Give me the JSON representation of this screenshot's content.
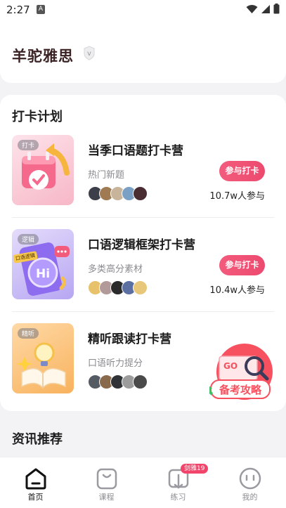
{
  "status_bar": {
    "time": "2:27",
    "notification_letter": "A"
  },
  "header": {
    "brand": "羊驼雅思",
    "badge_letter": "v"
  },
  "plan_section": {
    "title": "打卡计划",
    "camps": [
      {
        "tag": "打卡",
        "title": "当季口语题打卡营",
        "subtitle": "热门新题",
        "join_label": "参与打卡",
        "count": "10.7w人参与",
        "accent": "#f7b7c7"
      },
      {
        "tag": "逻辑",
        "tag2": "口语逻辑",
        "title": "口语逻辑框架打卡营",
        "subtitle": "多类高分素材",
        "join_label": "参与打卡",
        "count": "10.4w人参与",
        "accent": "#b7a6f2"
      },
      {
        "tag": "精听",
        "title": "精听跟读打卡营",
        "subtitle": "口语听力提分",
        "accent": "#f8c27a"
      }
    ],
    "promo": {
      "label": "备考攻略",
      "mini": "GO"
    }
  },
  "news_section": {
    "title": "资讯推荐"
  },
  "tabbar": {
    "tabs": [
      {
        "label": "首页",
        "icon": "home-icon",
        "active": true
      },
      {
        "label": "课程",
        "icon": "course-bag-icon",
        "active": false
      },
      {
        "label": "练习",
        "icon": "practice-book-icon",
        "active": false,
        "badge": "剑雅19"
      },
      {
        "label": "我的",
        "icon": "profile-face-icon",
        "active": false
      }
    ]
  },
  "colors": {
    "brand": "#3a2224",
    "accent": "#ec4a6e",
    "text": "#1f1f1f",
    "muted": "#8a8a8f"
  }
}
